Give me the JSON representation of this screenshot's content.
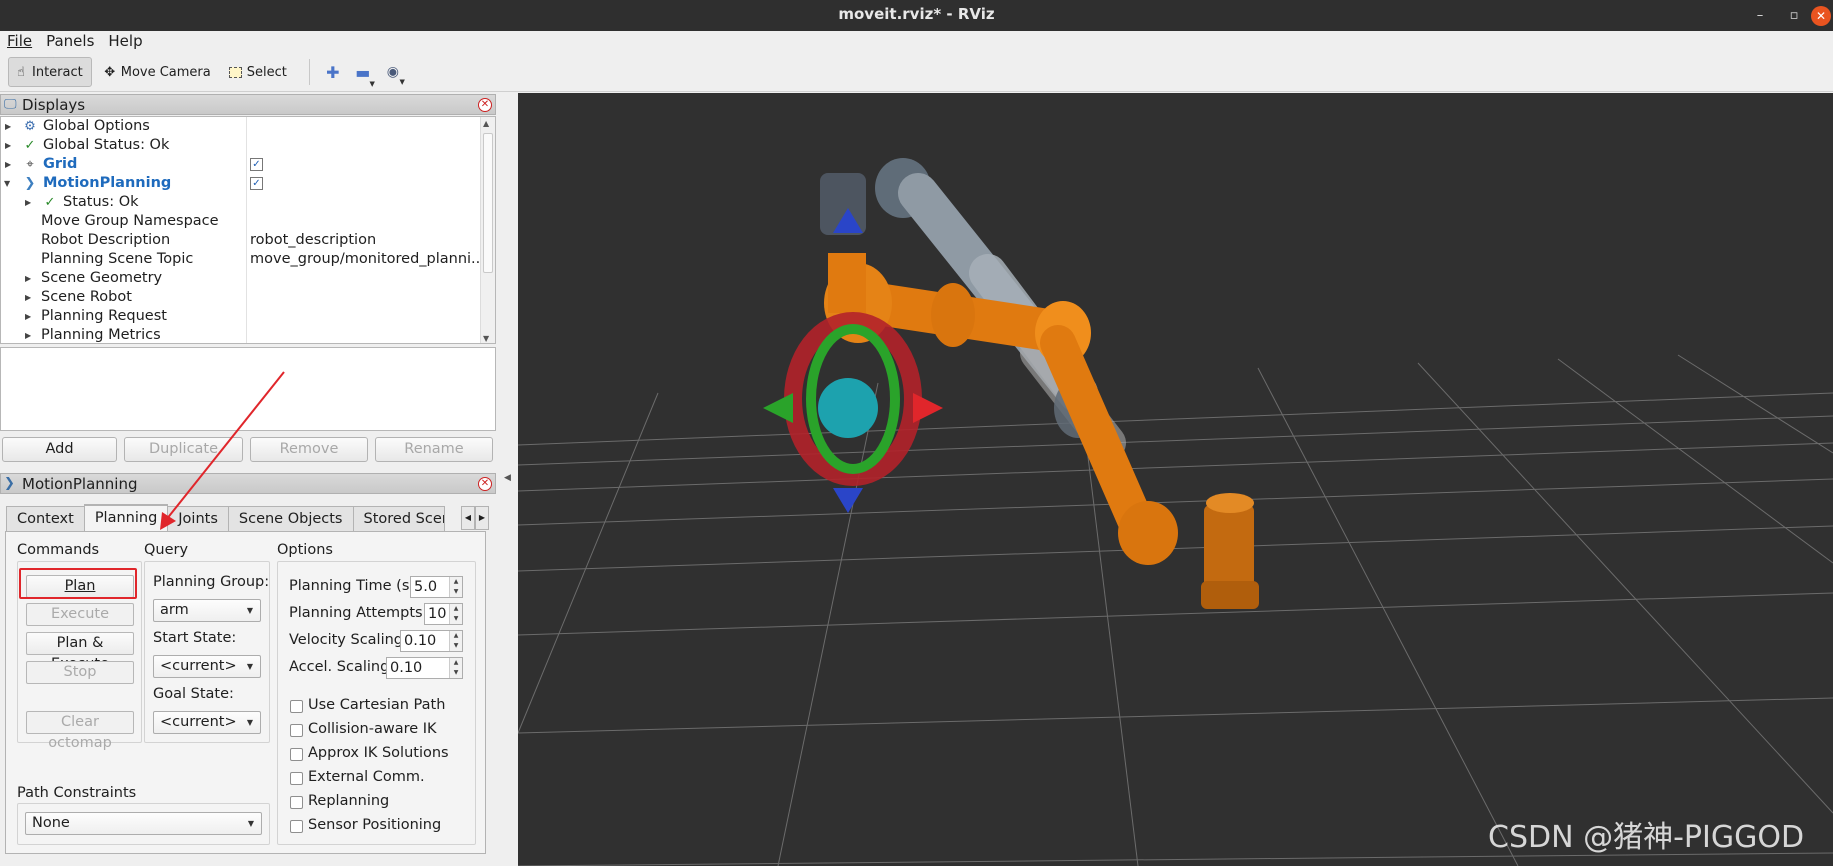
{
  "window": {
    "title": "moveit.rviz* - RViz",
    "minimize": "–",
    "restore": "▫",
    "close": "✕"
  },
  "menu": {
    "file": "File",
    "panels": "Panels",
    "help": "Help"
  },
  "toolbar": {
    "interact": "Interact",
    "move_camera": "Move Camera",
    "select": "Select"
  },
  "displays": {
    "title": "Displays",
    "items": [
      {
        "label": "Global Options",
        "value": ""
      },
      {
        "label": "Global Status: Ok",
        "value": ""
      },
      {
        "label": "Grid",
        "checked": true
      },
      {
        "label": "MotionPlanning",
        "checked": true
      },
      {
        "label": "Status: Ok",
        "value": ""
      },
      {
        "label": "Move Group Namespace",
        "value": ""
      },
      {
        "label": "Robot Description",
        "value": "robot_description"
      },
      {
        "label": "Planning Scene Topic",
        "value": "move_group/monitored_planni..."
      },
      {
        "label": "Scene Geometry",
        "value": ""
      },
      {
        "label": "Scene Robot",
        "value": ""
      },
      {
        "label": "Planning Request",
        "value": ""
      },
      {
        "label": "Planning Metrics",
        "value": ""
      }
    ],
    "buttons": {
      "add": "Add",
      "duplicate": "Duplicate",
      "remove": "Remove",
      "rename": "Rename"
    }
  },
  "motion": {
    "title": "MotionPlanning",
    "tabs": [
      "Context",
      "Planning",
      "Joints",
      "Scene Objects",
      "Stored Scene"
    ],
    "commands": {
      "title": "Commands",
      "plan": "Plan",
      "execute": "Execute",
      "plan_execute": "Plan & Execute",
      "stop": "Stop",
      "clear_octomap": "Clear octomap"
    },
    "query": {
      "title": "Query",
      "planning_group_label": "Planning Group:",
      "planning_group": "arm",
      "start_state_label": "Start State:",
      "start_state": "<current>",
      "goal_state_label": "Goal State:",
      "goal_state": "<current>"
    },
    "options": {
      "title": "Options",
      "planning_time_label": "Planning Time (s):",
      "planning_time": "5.0",
      "planning_attempts_label": "Planning Attempts:",
      "planning_attempts": "10",
      "velocity_label": "Velocity Scaling:",
      "velocity": "0.10",
      "accel_label": "Accel. Scaling:",
      "accel": "0.10",
      "checkboxes": [
        "Use Cartesian Path",
        "Collision-aware IK",
        "Approx IK Solutions",
        "External Comm.",
        "Replanning",
        "Sensor Positioning"
      ]
    },
    "path_constraints": {
      "label": "Path Constraints",
      "value": "None"
    }
  },
  "watermark": "CSDN @猪神-PIGGOD"
}
